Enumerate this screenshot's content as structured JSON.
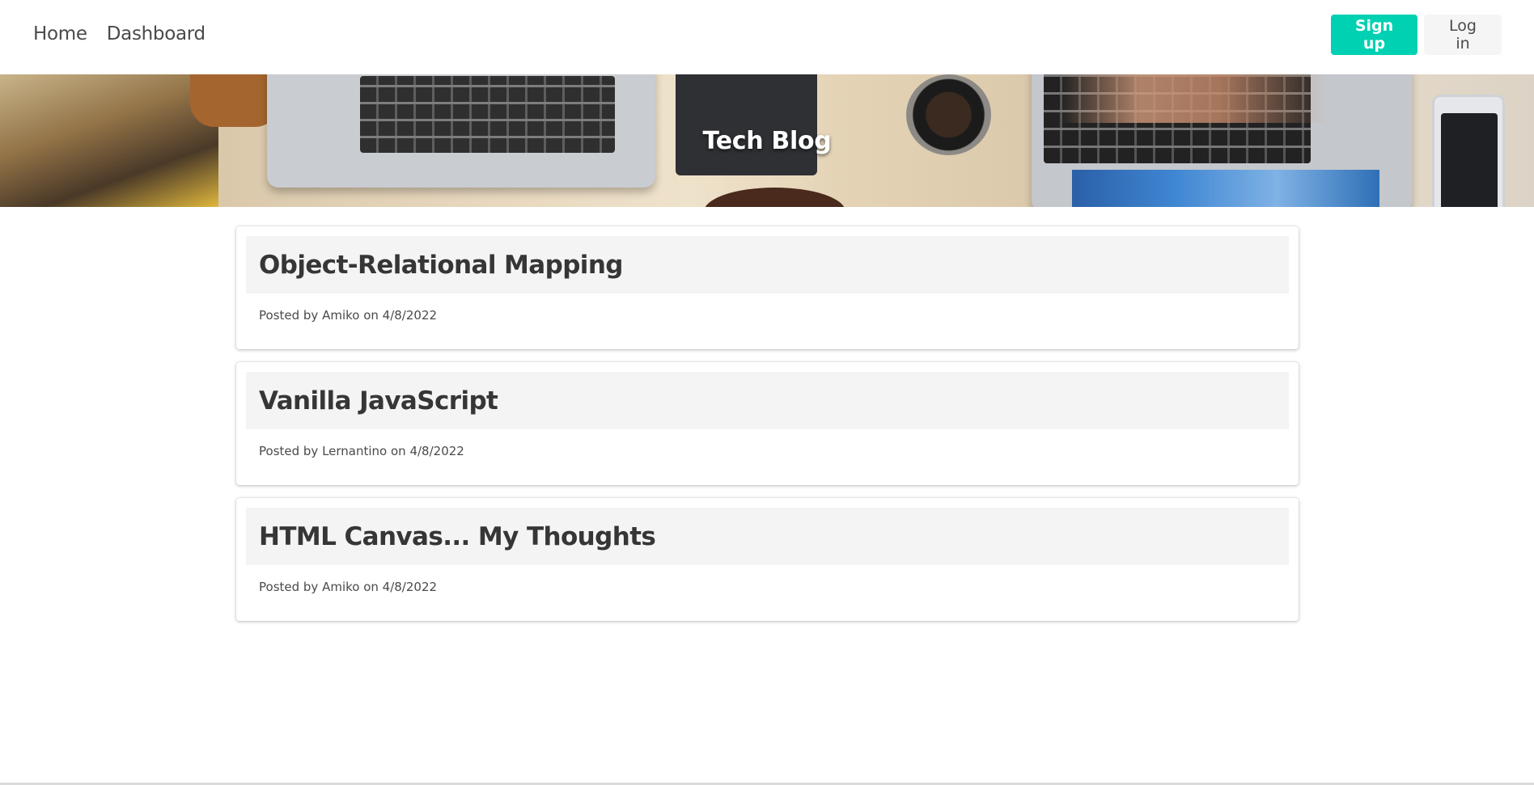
{
  "nav": {
    "home_label": "Home",
    "dashboard_label": "Dashboard",
    "signup_label": "Sign up",
    "login_label": "Log in"
  },
  "hero": {
    "title": "Tech Blog"
  },
  "posts": [
    {
      "title": "Object-Relational Mapping",
      "meta": "Posted by Amiko on 4/8/2022"
    },
    {
      "title": "Vanilla JavaScript",
      "meta": "Posted by Lernantino on 4/8/2022"
    },
    {
      "title": "HTML Canvas... My Thoughts",
      "meta": "Posted by Amiko on 4/8/2022"
    }
  ],
  "colors": {
    "primary": "#00d1b2",
    "light_button": "#f5f5f5",
    "card_header": "#f4f4f4"
  }
}
